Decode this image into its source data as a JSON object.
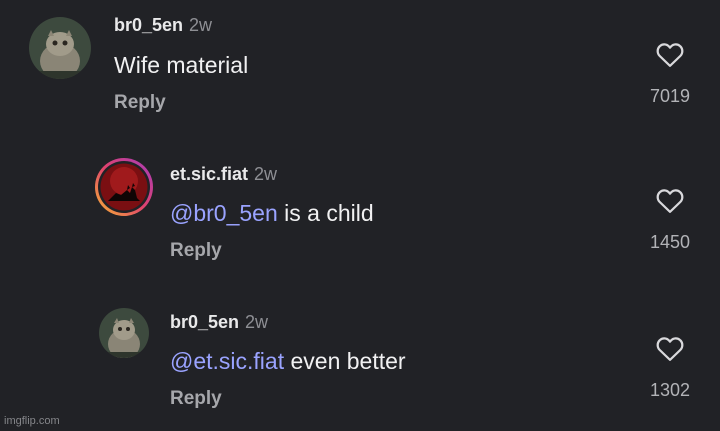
{
  "comments": [
    {
      "username": "br0_5en",
      "time": "2w",
      "text": "Wife material",
      "reply_label": "Reply",
      "like_count": "7019"
    },
    {
      "username": "et.sic.fiat",
      "time": "2w",
      "mention": "@br0_5en",
      "text": "is a child",
      "reply_label": "Reply",
      "like_count": "1450"
    },
    {
      "username": "br0_5en",
      "time": "2w",
      "mention": "@et.sic.fiat",
      "text": "even better",
      "reply_label": "Reply",
      "like_count": "1302"
    }
  ],
  "watermark": "imgflip.com",
  "colors": {
    "background": "#212226",
    "mention": "#9aa3ff",
    "story_ring": "#e0426e"
  },
  "icons": {
    "like": "heart-outline-icon"
  }
}
